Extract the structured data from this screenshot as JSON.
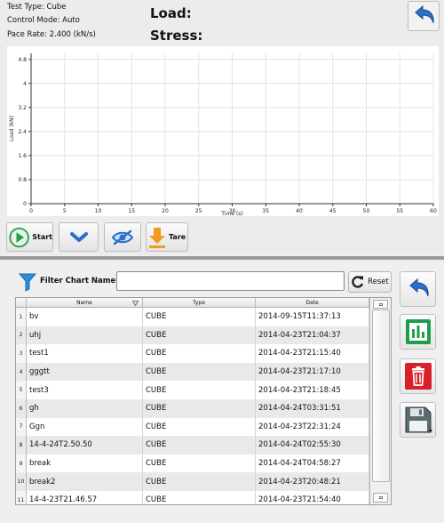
{
  "header": {
    "test_type": "Test Type: Cube",
    "control_mode": "Control Mode: Auto",
    "pace_rate": "Pace Rate: 2.400 (kN/s)",
    "load_label": "Load:",
    "stress_label": "Stress:"
  },
  "chart_data": {
    "type": "line",
    "xlabel": "Time (s)",
    "ylabel": "Load (kN)",
    "xlim": [
      0,
      60
    ],
    "ylim": [
      0,
      5
    ],
    "xticks": [
      "0",
      "5",
      "10",
      "15",
      "20",
      "25",
      "30",
      "35",
      "40",
      "45",
      "50",
      "55",
      "60"
    ],
    "yticks": [
      "0",
      "0.8",
      "1.6",
      "2.4",
      "3.2",
      "4",
      "4.8"
    ],
    "series": [],
    "grid": true
  },
  "toolbar": {
    "start_label": "Start",
    "tare_label": "Tare"
  },
  "filter": {
    "label": "Filter Chart Name:",
    "value": "",
    "reset_label": "Reset"
  },
  "table": {
    "columns": [
      "Name",
      "Type",
      "Date"
    ],
    "rows": [
      {
        "n": "1",
        "name": "bv",
        "type": "CUBE",
        "date": "2014-09-15T11:37:13"
      },
      {
        "n": "2",
        "name": "uhj",
        "type": "CUBE",
        "date": "2014-04-23T21:04:37"
      },
      {
        "n": "3",
        "name": "test1",
        "type": "CUBE",
        "date": "2014-04-23T21:15:40"
      },
      {
        "n": "4",
        "name": "gggtt",
        "type": "CUBE",
        "date": "2014-04-23T21:17:10"
      },
      {
        "n": "5",
        "name": "test3",
        "type": "CUBE",
        "date": "2014-04-23T21:18:45"
      },
      {
        "n": "6",
        "name": "gh",
        "type": "CUBE",
        "date": "2014-04-24T03:31:51"
      },
      {
        "n": "7",
        "name": "Ggn",
        "type": "CUBE",
        "date": "2014-04-23T22:31:24"
      },
      {
        "n": "8",
        "name": "14-4-24T2.50.50",
        "type": "CUBE",
        "date": "2014-04-24T02:55:30"
      },
      {
        "n": "9",
        "name": "break",
        "type": "CUBE",
        "date": "2014-04-24T04:58:27"
      },
      {
        "n": "10",
        "name": "break2",
        "type": "CUBE",
        "date": "2014-04-23T20:48:21"
      },
      {
        "n": "11",
        "name": "14-4-23T21.46.57",
        "type": "CUBE",
        "date": "2014-04-23T21:54:40"
      }
    ]
  },
  "colors": {
    "accent_blue": "#2a6fc9",
    "green": "#1e9e4a",
    "red": "#d8202a",
    "orange": "#f29a1e"
  },
  "icons": [
    "undo-arrow-icon",
    "play-icon",
    "chevron-down-icon",
    "hidden-eye-icon",
    "tare-arrow-icon",
    "filter-funnel-icon",
    "reset-icon",
    "bar-chart-icon",
    "trash-icon",
    "floppy-disk-icon"
  ]
}
